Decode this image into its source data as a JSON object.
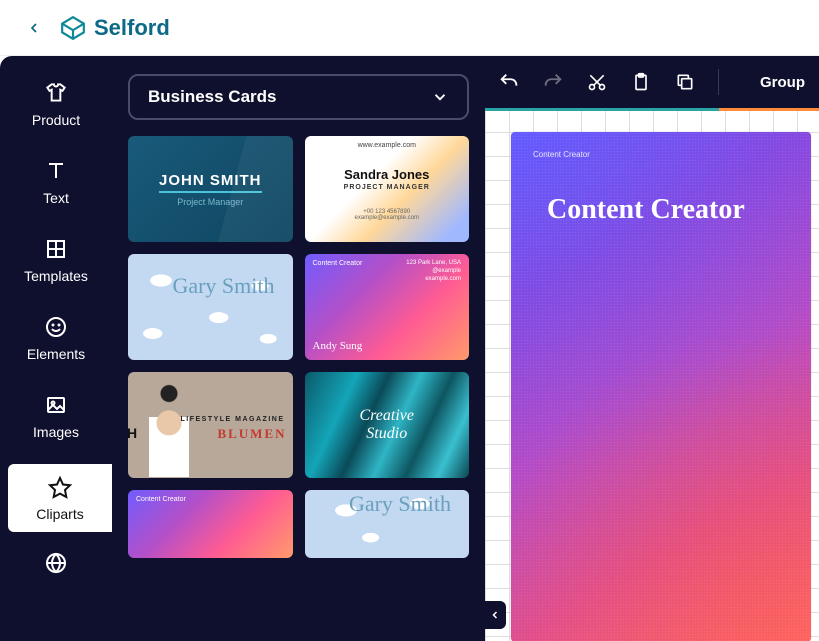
{
  "header": {
    "brand": "Selford"
  },
  "nav": {
    "items": [
      {
        "label": "Product"
      },
      {
        "label": "Text"
      },
      {
        "label": "Templates"
      },
      {
        "label": "Elements"
      },
      {
        "label": "Images"
      },
      {
        "label": "Cliparts"
      }
    ]
  },
  "panel": {
    "dropdown_label": "Business Cards",
    "cards": [
      {
        "name": "JOHN SMITH",
        "role": "Project Manager"
      },
      {
        "site": "www.example.com",
        "name": "Sandra Jones",
        "role": "PROJECT MANAGER",
        "phone": "+00 123 4567890",
        "email": "example@example.com"
      },
      {
        "name": "Gary Smith"
      },
      {
        "title": "Content Creator",
        "name": "Andy Sung",
        "addr1": "123 Park Lane, USA",
        "addr2": "@example",
        "addr3": "example.com"
      },
      {
        "stripe": "H",
        "magazine": "LIFESTYLE MAGAZINE",
        "brand": "BLUMEN"
      },
      {
        "line1": "Creative",
        "line2": "Studio"
      },
      {
        "title": "Content Creator"
      },
      {
        "name": "Gary Smith"
      }
    ]
  },
  "toolbar": {
    "group_label": "Group"
  },
  "canvas": {
    "small_title": "Content Creator",
    "title": "Content Creator"
  }
}
